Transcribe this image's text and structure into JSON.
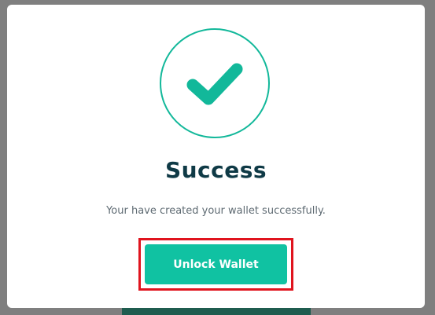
{
  "dialog": {
    "title": "Success",
    "message": "Your have created your wallet successfully.",
    "icon": "check-icon",
    "primary_button_label": "Unlock Wallet"
  },
  "colors": {
    "accent": "#10c2a2",
    "icon_color": "#12b89a",
    "title_color": "#0f3a46",
    "message_color": "#5f6b73",
    "highlight_border": "#e0141e",
    "backdrop": "#7f7f7f"
  }
}
